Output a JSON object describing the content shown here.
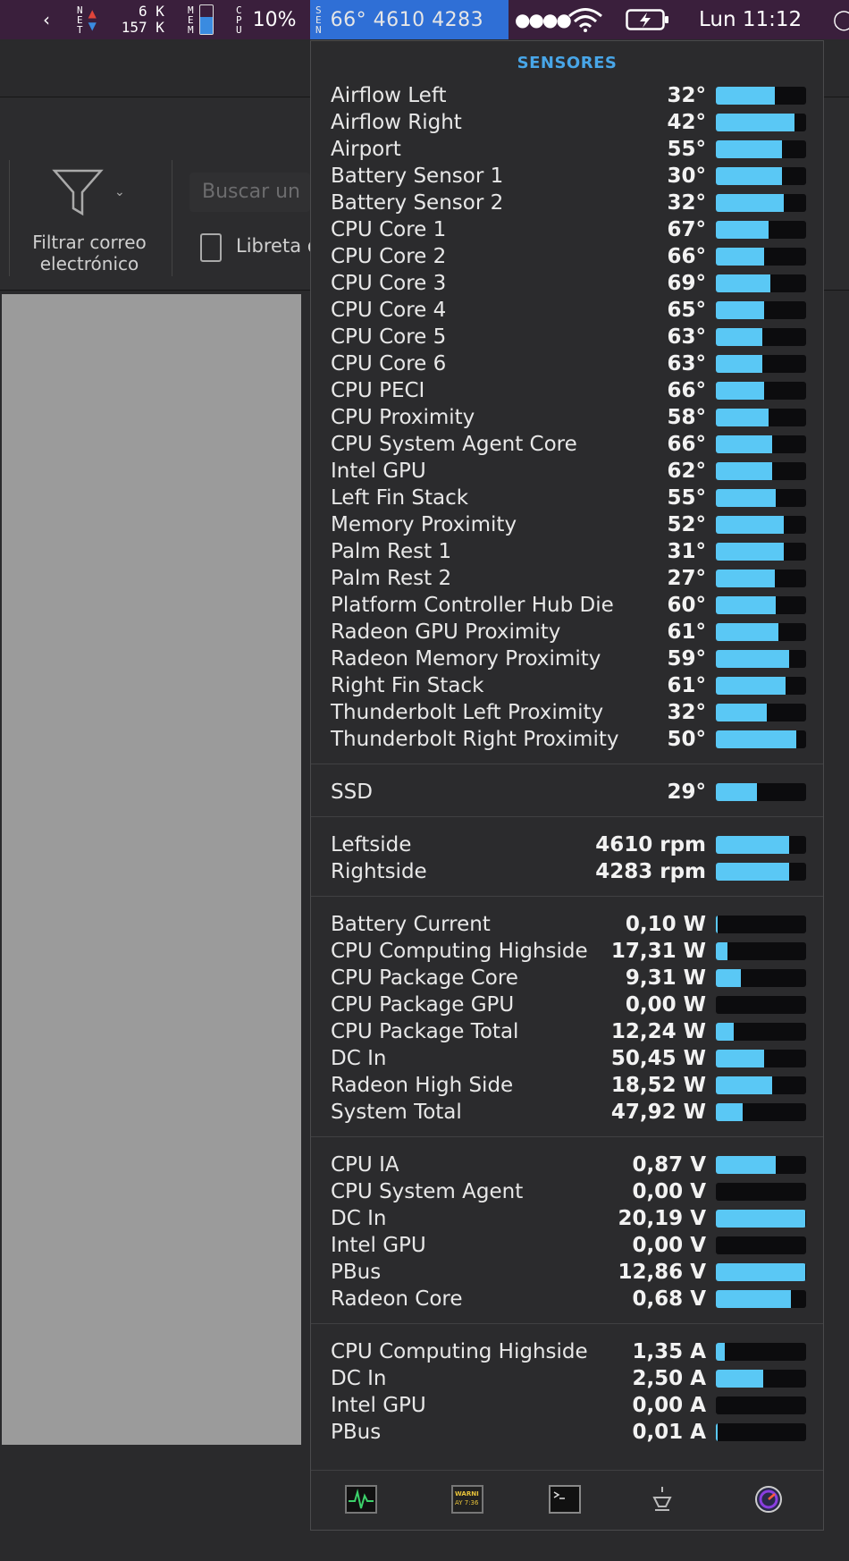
{
  "menubar": {
    "net": {
      "label_top": "N",
      "label_bot": "T",
      "up": "6 K",
      "down": "157 K"
    },
    "mem_label": "MEM",
    "cpu_label": "CPU",
    "cpu_percent": "10%",
    "sen_label": "SEN",
    "sensor_summary": "66° 4610 4283",
    "wifi_icon": "wifi-icon",
    "battery_icon": "battery-charging-icon",
    "clock": "Lun 11:12"
  },
  "background": {
    "filter_label_1": "Filtrar correo",
    "filter_label_2": "electrónico",
    "search_placeholder": "Buscar un",
    "contacts_label": "Libreta d"
  },
  "panel": {
    "title": "SENSORES",
    "temperatures": [
      {
        "name": "Airflow Left",
        "value": "32°",
        "level": 0.65
      },
      {
        "name": "Airflow Right",
        "value": "42°",
        "level": 0.87
      },
      {
        "name": "Airport",
        "value": "55°",
        "level": 0.73
      },
      {
        "name": "Battery Sensor 1",
        "value": "30°",
        "level": 0.73
      },
      {
        "name": "Battery Sensor 2",
        "value": "32°",
        "level": 0.75
      },
      {
        "name": "CPU Core 1",
        "value": "67°",
        "level": 0.58
      },
      {
        "name": "CPU Core 2",
        "value": "66°",
        "level": 0.53
      },
      {
        "name": "CPU Core 3",
        "value": "69°",
        "level": 0.6
      },
      {
        "name": "CPU Core 4",
        "value": "65°",
        "level": 0.53
      },
      {
        "name": "CPU Core 5",
        "value": "63°",
        "level": 0.51
      },
      {
        "name": "CPU Core 6",
        "value": "63°",
        "level": 0.51
      },
      {
        "name": "CPU PECI",
        "value": "66°",
        "level": 0.53
      },
      {
        "name": "CPU Proximity",
        "value": "58°",
        "level": 0.58
      },
      {
        "name": "CPU System Agent Core",
        "value": "66°",
        "level": 0.62
      },
      {
        "name": "Intel GPU",
        "value": "62°",
        "level": 0.62
      },
      {
        "name": "Left Fin Stack",
        "value": "55°",
        "level": 0.66
      },
      {
        "name": "Memory Proximity",
        "value": "52°",
        "level": 0.75
      },
      {
        "name": "Palm Rest 1",
        "value": "31°",
        "level": 0.75
      },
      {
        "name": "Palm Rest 2",
        "value": "27°",
        "level": 0.65
      },
      {
        "name": "Platform Controller Hub Die",
        "value": "60°",
        "level": 0.66
      },
      {
        "name": "Radeon GPU Proximity",
        "value": "61°",
        "level": 0.69
      },
      {
        "name": "Radeon Memory Proximity",
        "value": "59°",
        "level": 0.81
      },
      {
        "name": "Right Fin Stack",
        "value": "61°",
        "level": 0.77
      },
      {
        "name": "Thunderbolt Left Proximity",
        "value": "32°",
        "level": 0.56
      },
      {
        "name": "Thunderbolt Right Proximity",
        "value": "50°",
        "level": 0.89
      }
    ],
    "disk": [
      {
        "name": "SSD",
        "value": "29°",
        "level": 0.46
      }
    ],
    "fans": [
      {
        "name": "Leftside",
        "value": "4610 rpm",
        "level": 0.81
      },
      {
        "name": "Rightside",
        "value": "4283 rpm",
        "level": 0.81
      }
    ],
    "power": [
      {
        "name": "Battery Current",
        "value": "0,10 W",
        "level": 0.02
      },
      {
        "name": "CPU Computing Highside",
        "value": "17,31 W",
        "level": 0.13
      },
      {
        "name": "CPU Package Core",
        "value": "9,31 W",
        "level": 0.28
      },
      {
        "name": "CPU Package GPU",
        "value": "0,00 W",
        "level": 0.0
      },
      {
        "name": "CPU Package Total",
        "value": "12,24 W",
        "level": 0.2
      },
      {
        "name": "DC In",
        "value": "50,45 W",
        "level": 0.53
      },
      {
        "name": "Radeon High Side",
        "value": "18,52 W",
        "level": 0.62
      },
      {
        "name": "System Total",
        "value": "47,92 W",
        "level": 0.3
      }
    ],
    "voltage": [
      {
        "name": "CPU IA",
        "value": "0,87 V",
        "level": 0.66
      },
      {
        "name": "CPU System Agent",
        "value": "0,00 V",
        "level": 0.0
      },
      {
        "name": "DC In",
        "value": "20,19 V",
        "level": 0.99
      },
      {
        "name": "Intel GPU",
        "value": "0,00 V",
        "level": 0.0
      },
      {
        "name": "PBus",
        "value": "12,86 V",
        "level": 0.99
      },
      {
        "name": "Radeon Core",
        "value": "0,68 V",
        "level": 0.83
      }
    ],
    "current": [
      {
        "name": "CPU Computing Highside",
        "value": "1,35 A",
        "level": 0.1
      },
      {
        "name": "DC In",
        "value": "2,50 A",
        "level": 0.52
      },
      {
        "name": "Intel GPU",
        "value": "0,00 A",
        "level": 0.0
      },
      {
        "name": "PBus",
        "value": "0,01 A",
        "level": 0.02
      }
    ],
    "dock": [
      {
        "icon": "activity-monitor-icon"
      },
      {
        "icon": "console-icon",
        "text_1": "WARNI",
        "text_2": "AY 7:36"
      },
      {
        "icon": "terminal-icon"
      },
      {
        "icon": "system-information-icon"
      },
      {
        "icon": "istat-menus-icon"
      }
    ]
  }
}
